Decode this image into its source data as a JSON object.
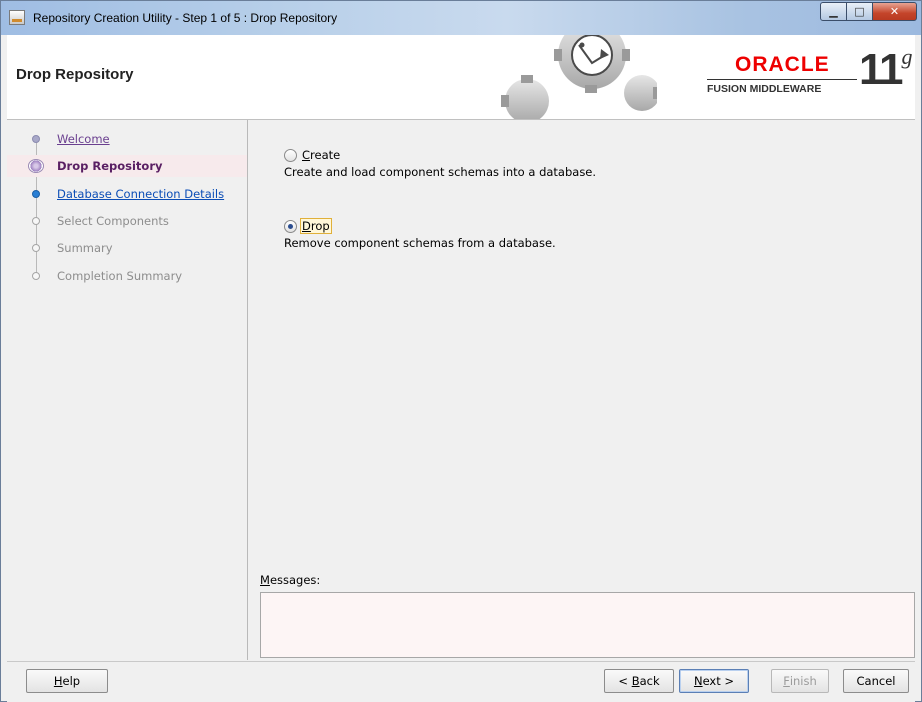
{
  "window": {
    "title": "Repository Creation Utility - Step 1 of 5 : Drop Repository",
    "minimize_glyph": "▁",
    "maximize_glyph": "□",
    "close_glyph": "✕"
  },
  "header": {
    "page_title": "Drop Repository",
    "logo_word": "ORACLE",
    "logo_sub": "FUSION MIDDLEWARE",
    "version_num": "11",
    "version_suffix": "g",
    "brand_color": "#e00000"
  },
  "sidebar": {
    "steps": [
      {
        "label": "Welcome",
        "state": "visited"
      },
      {
        "label": "Drop Repository",
        "state": "current"
      },
      {
        "label": "Database Connection Details",
        "state": "next"
      },
      {
        "label": "Select Components",
        "state": "disabled"
      },
      {
        "label": "Summary",
        "state": "disabled"
      },
      {
        "label": "Completion Summary",
        "state": "disabled"
      }
    ]
  },
  "main": {
    "options": [
      {
        "mnemonic": "C",
        "rest": "reate",
        "description": "Create and load component schemas into a database.",
        "selected": false
      },
      {
        "mnemonic": "D",
        "rest": "rop",
        "description": "Remove component schemas from a database.",
        "selected": true
      }
    ],
    "messages_label_mnemonic": "M",
    "messages_label_rest": "essages:",
    "messages_text": ""
  },
  "footer": {
    "help": {
      "mnemonic": "H",
      "rest": "elp"
    },
    "back": {
      "pre": "< ",
      "mnemonic": "B",
      "rest": "ack"
    },
    "next": {
      "mnemonic": "N",
      "rest": "ext >"
    },
    "finish": {
      "mnemonic": "F",
      "rest": "inish"
    },
    "cancel": "Cancel"
  }
}
